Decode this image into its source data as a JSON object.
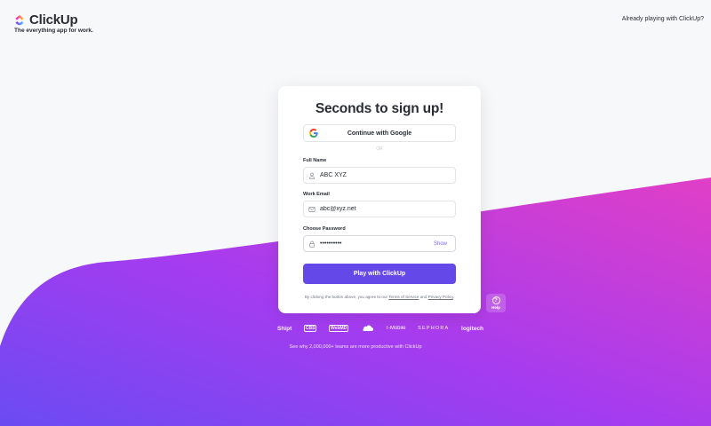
{
  "header": {
    "logo_text": "ClickUp",
    "tagline": "The everything app for work.",
    "already_link": "Already playing with ClickUp?"
  },
  "form": {
    "title": "Seconds to sign up!",
    "google_button": "Continue with Google",
    "or_text": "OR",
    "full_name": {
      "label": "Full Name",
      "value": "ABC XYZ"
    },
    "work_email": {
      "label": "Work Email",
      "value": "abc@xyz.net"
    },
    "password": {
      "label": "Choose Password",
      "value": "••••••••••",
      "show_label": "Show"
    },
    "submit_button": "Play with ClickUp",
    "terms": {
      "prefix": "By clicking the button above, you agree to our ",
      "terms_link": "Terms of Service",
      "and": " and ",
      "privacy_link": "Privacy Policy",
      "suffix": "."
    }
  },
  "help": {
    "label": "Help",
    "icon": "question-icon"
  },
  "brands": {
    "items": [
      "Shipt",
      "CBS",
      "WebMD",
      "Cloudflare",
      "T-Mobile",
      "SEPHORA",
      "logitech"
    ],
    "caption": "See why 2,000,000+ teams are more productive with ClickUp"
  },
  "colors": {
    "primary": "#6549e8",
    "wave_start": "#7b3cf0",
    "wave_end": "#e040c8",
    "link": "#7b68ee"
  }
}
